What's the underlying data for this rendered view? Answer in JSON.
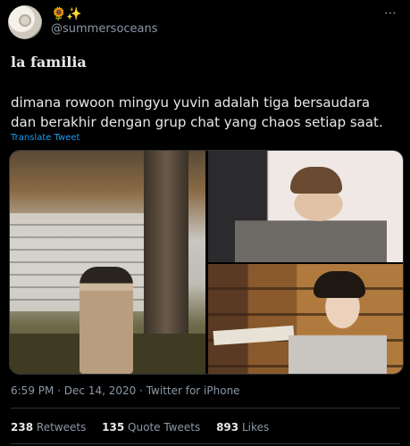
{
  "tweet": {
    "author_name": "🌻✨",
    "handle": "@summersoceans",
    "more_icon": "⋯",
    "title": "la familia",
    "body_line1": "dimana rowoon mingyu yuvin adalah tiga bersaudara",
    "body_line2": "dan berakhir dengan grup chat yang chaos setiap saat.",
    "translate_link": "Translate Tweet",
    "meta": "6:59 PM · Dec 14, 2020 · Twitter for iPhone",
    "stats": {
      "retweets_count": "238",
      "retweets_label": "Retweets",
      "quote_count": "135",
      "quote_label": "Quote Tweets",
      "likes_count": "893",
      "likes_label": "Likes"
    }
  }
}
